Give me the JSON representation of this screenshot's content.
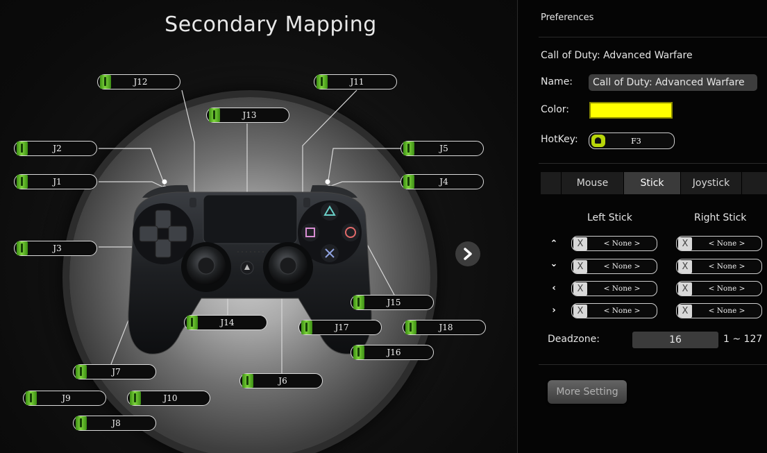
{
  "title": "Secondary Mapping",
  "mapping_labels": {
    "J1": "J1",
    "J2": "J2",
    "J3": "J3",
    "J4": "J4",
    "J5": "J5",
    "J6": "J6",
    "J7": "J7",
    "J8": "J8",
    "J9": "J9",
    "J10": "J10",
    "J11": "J11",
    "J12": "J12",
    "J13": "J13",
    "J14": "J14",
    "J15": "J15",
    "J16": "J16",
    "J17": "J17",
    "J18": "J18"
  },
  "next_icon": "chevron-right-icon",
  "preferences": {
    "header": "Preferences",
    "profile_title": "Call of Duty: Advanced Warfare",
    "name_label": "Name:",
    "name_value": "Call of Duty: Advanced Warfare",
    "color_label": "Color:",
    "color_value": "#ffff00",
    "hotkey_label": "HotKey:",
    "hotkey_value": "F3"
  },
  "tabs": [
    {
      "label": ""
    },
    {
      "label": "Mouse"
    },
    {
      "label": "Stick",
      "active": true
    },
    {
      "label": "Joystick"
    },
    {
      "label": ""
    }
  ],
  "sticks": {
    "left_header": "Left Stick",
    "right_header": "Right Stick",
    "rows": [
      {
        "arrow": "up",
        "left": "< None >",
        "right": "< None >"
      },
      {
        "arrow": "down",
        "left": "< None >",
        "right": "< None >"
      },
      {
        "arrow": "left",
        "left": "< None >",
        "right": "< None >"
      },
      {
        "arrow": "right",
        "left": "< None >",
        "right": "< None >"
      }
    ],
    "clear_label": "X"
  },
  "deadzone": {
    "label": "Deadzone:",
    "value": "16",
    "range": "1 ~ 127"
  },
  "more_setting": "More Setting",
  "colors": {
    "indicator_green": "#7ed43c",
    "accent_yellow": "#ffff00"
  }
}
